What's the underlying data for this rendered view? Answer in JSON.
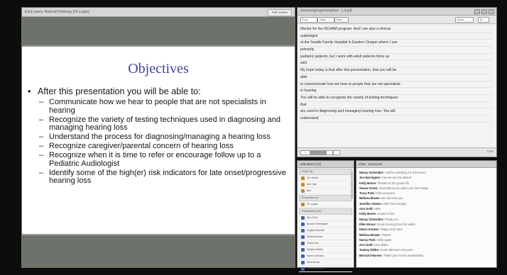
{
  "presentation": {
    "window_title": "Early years: Referral Pathway (Dr.Logan)",
    "top_button_label": "Full screen",
    "slide": {
      "title": "Objectives",
      "intro": "After this presentation you will be able to:",
      "bullets": [
        "Communicate how we hear to people that are not specialists in hearing",
        "Recognize the variety of testing techniques used in diagnosing and managing hearing loss",
        "Understand the process for diagnosing/managing a hearing loss",
        "Recognize caregiver/parental concern of hearing loss",
        "Recognize when it is time to refer or encourage follow up to a Pediatric Audiologist",
        "Identify some of the high(er) risk indicators for late onset/progressive hearing loss"
      ]
    }
  },
  "captions": {
    "window_title": "StreamingCaptioningText - 1.2.pdf",
    "toolbar": [
      "Font",
      "Color",
      "Print",
      "Zoom"
    ],
    "lines": [
      "Mentor for the NCHAM program. And I am also a clinical",
      "audiologist",
      "at the Seattle Family Hospital in Eastern Oregon where I see",
      "primarily",
      "pediatric patients, but I work with adult patients there as",
      "well.",
      "My hope today is that after this presentation, that you will be",
      "able",
      "to communicate how we hear to people that are not specialists",
      "in hearing.",
      "You will be able to recognize the variety of testing techniques",
      "that",
      "are used in diagnosing and managing hearing loss. You will",
      "understand"
    ],
    "scroll_percent": "100%"
  },
  "attendees": {
    "title": "Attendees (14)",
    "groups": [
      {
        "label": "Hosts (3)",
        "members": [
          {
            "name": "Jen Smith",
            "role": "host"
          },
          {
            "name": "Kim Hall",
            "role": "host"
          },
          {
            "name": "Ann",
            "role": "host"
          }
        ]
      },
      {
        "label": "Presenters (1)",
        "members": [
          {
            "name": "Dr. Logan",
            "role": "host"
          }
        ]
      },
      {
        "label": "Participants (10)",
        "members": [
          {
            "name": "Ann Gold",
            "role": "participant"
          },
          {
            "name": "Bonnie Remington",
            "role": "participant"
          },
          {
            "name": "Angela Bennett",
            "role": "participant"
          },
          {
            "name": "Debra Kramer",
            "role": "participant"
          },
          {
            "name": "Cindy Sue",
            "role": "participant"
          },
          {
            "name": "Sydney Martin",
            "role": "participant"
          },
          {
            "name": "Karen Leonard",
            "role": "participant"
          },
          {
            "name": "Ellen Bruce",
            "role": "participant"
          },
          {
            "name": "Jennifer Adams",
            "role": "participant"
          }
        ]
      }
    ]
  },
  "chat": {
    "title": "Chat - Everyone",
    "messages": [
      {
        "from": "Nancy Schneider:",
        "text": "I will be watching it in full screen"
      },
      {
        "from": "Jen Harrington:",
        "text": "Can we see the slides?"
      },
      {
        "from": "Kelly Moore:",
        "text": "Thanks for the great info"
      },
      {
        "from": "Susan Green:",
        "text": "Good afternoon, glad to be here today"
      },
      {
        "from": "Tracy Park:",
        "text": "hello everyone"
      },
      {
        "from": "Melissa Brown:",
        "text": "we can hear you"
      },
      {
        "from": "Jennifer Adams:",
        "text": "Hello from Oregon"
      },
      {
        "from": "Ann Gold:",
        "text": "Hello"
      },
      {
        "from": "Kelly Moore:",
        "text": "Sound is fine"
      },
      {
        "from": "Nancy Schneider:",
        "text": "Thank you"
      },
      {
        "from": "Ellen Bruce:",
        "text": "Good morning from the valley"
      },
      {
        "from": "Debra Kramer:",
        "text": "Happy to be here"
      },
      {
        "from": "Melissa Brown:",
        "text": "Thanks"
      },
      {
        "from": "Nancy Park:",
        "text": "Hello again"
      },
      {
        "from": "Ann Gold:",
        "text": "Nice slides"
      },
      {
        "from": "Tammy Gibbs:",
        "text": "Good afternoon everyone"
      },
      {
        "from": "Bernard Hansen:",
        "text": "Thank you for this presentation"
      }
    ]
  }
}
